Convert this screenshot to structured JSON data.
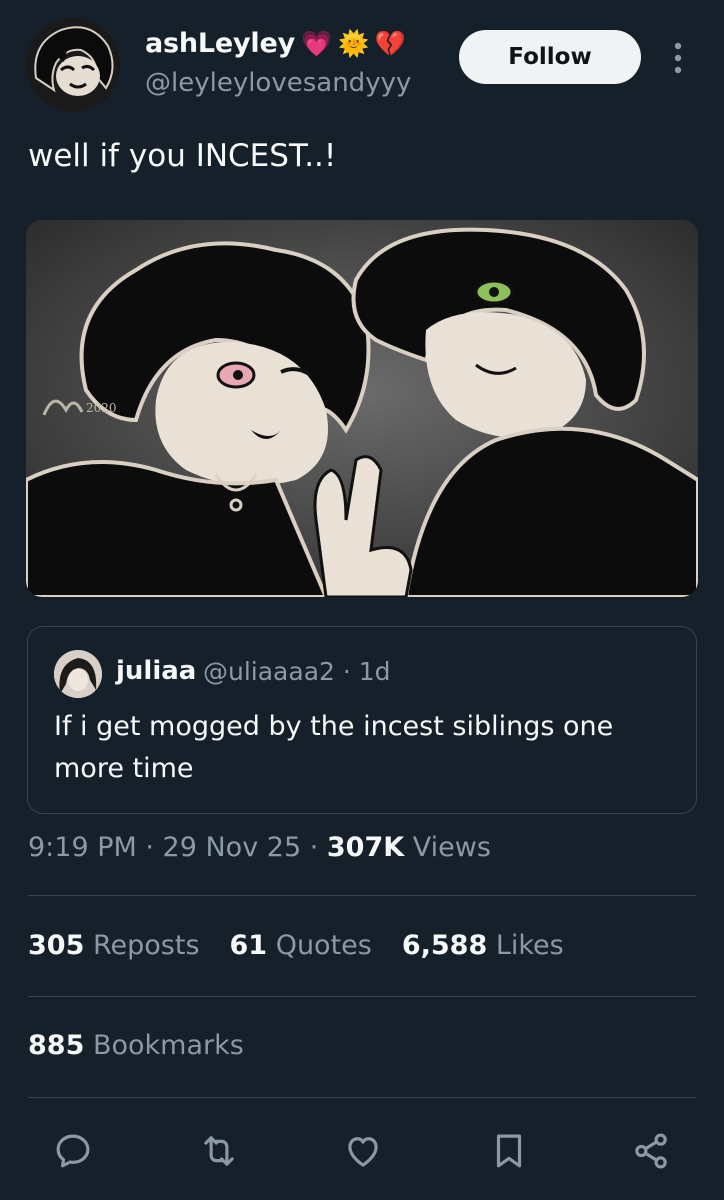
{
  "author": {
    "display_name": "ashLeyley",
    "name_emojis": [
      "💗",
      "🌞",
      "💔"
    ],
    "handle": "@leyleylovesandyyy"
  },
  "follow_label": "Follow",
  "tweet_text": "well if you INCEST..!",
  "media": {
    "signature": "2020"
  },
  "quote": {
    "name": "juliaa",
    "handle": "@uliaaaa2 · 1d",
    "text": "If i get mogged by the incest siblings one more time"
  },
  "meta": {
    "time": "9:19 PM",
    "sep1": " · ",
    "date": "29 Nov 25",
    "sep2": " · ",
    "views_count": "307K",
    "views_label": " Views"
  },
  "stats": [
    {
      "count": "305",
      "label": "Reposts"
    },
    {
      "count": "61",
      "label": "Quotes"
    },
    {
      "count": "6,588",
      "label": "Likes"
    }
  ],
  "bookmarks": {
    "count": "885",
    "label": "Bookmarks"
  },
  "actions": [
    "reply-icon",
    "repost-icon",
    "like-icon",
    "bookmark-icon",
    "share-icon"
  ],
  "colors": {
    "background": "#15202b",
    "text": "#f7f9f9",
    "secondary": "#8b98a5",
    "divider": "#38444d",
    "follow_bg": "#eff3f4"
  }
}
